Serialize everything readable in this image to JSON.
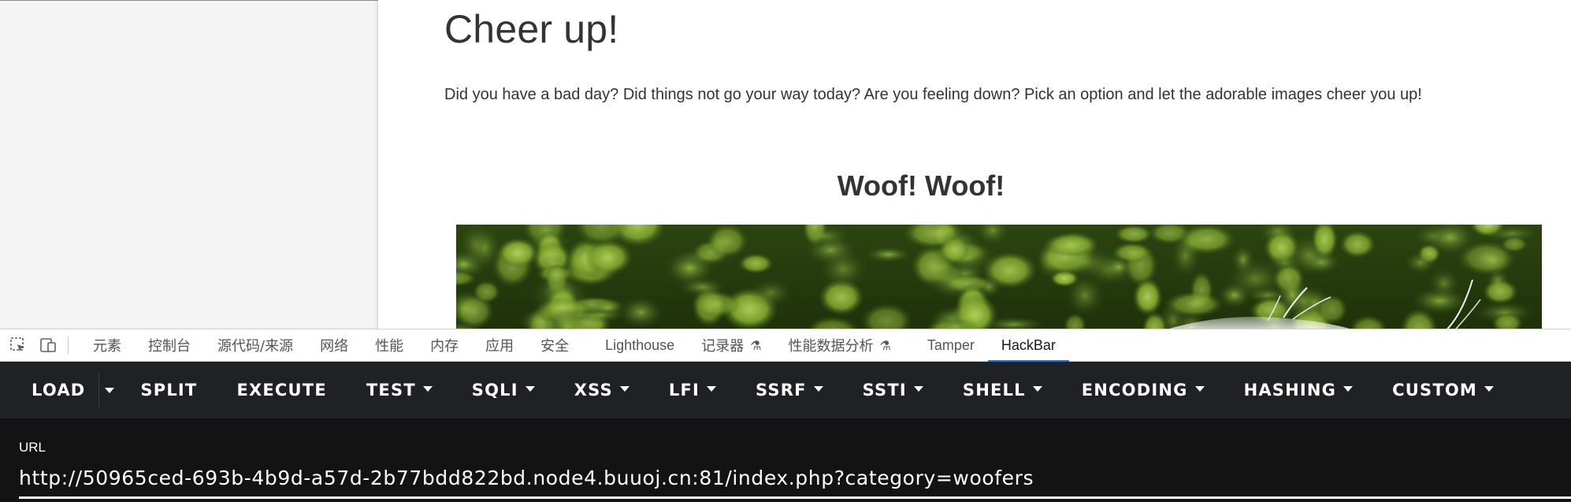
{
  "page": {
    "title": "Cheer up!",
    "description": "Did you have a bad day? Did things not go your way today? Are you feeling down? Pick an option and let the adorable images cheer you up!",
    "section_title": "Woof! Woof!"
  },
  "devtools": {
    "tabs": [
      {
        "label": "元素"
      },
      {
        "label": "控制台"
      },
      {
        "label": "源代码/来源"
      },
      {
        "label": "网络"
      },
      {
        "label": "性能"
      },
      {
        "label": "内存"
      },
      {
        "label": "应用"
      },
      {
        "label": "安全"
      },
      {
        "label": "Lighthouse"
      },
      {
        "label": "记录器"
      },
      {
        "label": "性能数据分析"
      },
      {
        "label": "Tamper"
      },
      {
        "label": "HackBar"
      }
    ],
    "active_tab": "HackBar",
    "icons": [
      "inspect-element-icon",
      "device-toolbar-icon",
      "flask-icon"
    ],
    "accent_color": "#1a73e8"
  },
  "hackbar": {
    "buttons": {
      "load": "LOAD",
      "split": "SPLIT",
      "execute": "EXECUTE",
      "test": "TEST",
      "sqli": "SQLI",
      "xss": "XSS",
      "lfi": "LFI",
      "ssrf": "SSRF",
      "ssti": "SSTI",
      "shell": "SHELL",
      "encoding": "ENCODING",
      "hashing": "HASHING",
      "custom": "CUSTOM"
    },
    "url_label": "URL",
    "url_value": "http://50965ced-693b-4b9d-a57d-2b77bdd822bd.node4.buuoj.cn:81/index.php?category=woofers",
    "toolbar_color": "#202124",
    "body_color": "#131313"
  }
}
